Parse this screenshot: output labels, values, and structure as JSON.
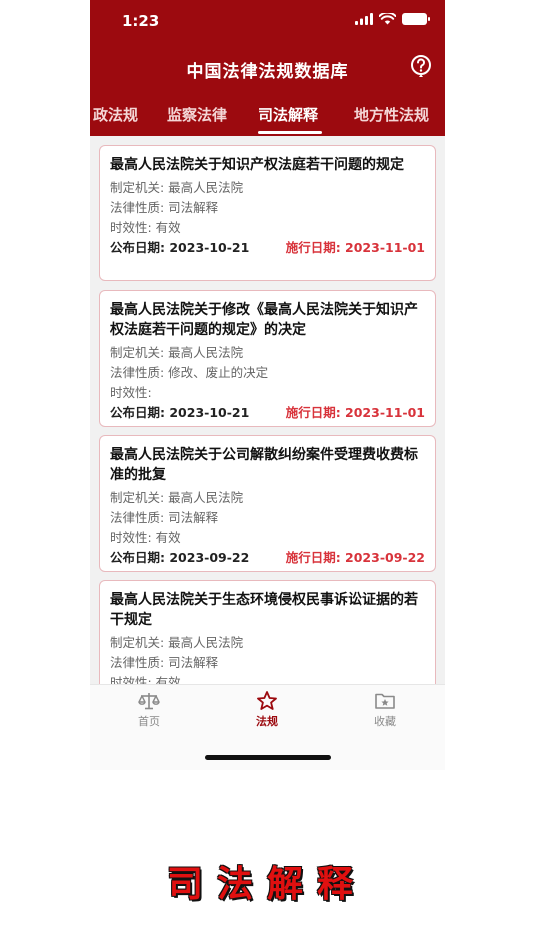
{
  "status_bar": {
    "time": "1:23"
  },
  "header": {
    "title": "中国法律法规数据库"
  },
  "tabs": [
    {
      "label": "政法规",
      "active": false
    },
    {
      "label": "监察法律",
      "active": false
    },
    {
      "label": "司法解释",
      "active": true
    },
    {
      "label": "地方性法规",
      "active": false
    }
  ],
  "cards": [
    {
      "title": "最高人民法院关于知识产权法庭若干问题的规定",
      "authority": "制定机关: 最高人民法院",
      "nature": "法律性质: 司法解释",
      "validity": "时效性: 有效",
      "publish_date": "公布日期: 2023-10-21",
      "effective_date": "施行日期: 2023-11-01"
    },
    {
      "title": "最高人民法院关于修改《最高人民法院关于知识产权法庭若干问题的规定》的决定",
      "authority": "制定机关: 最高人民法院",
      "nature": "法律性质: 修改、废止的决定",
      "validity": "时效性:",
      "publish_date": "公布日期: 2023-10-21",
      "effective_date": "施行日期: 2023-11-01"
    },
    {
      "title": "最高人民法院关于公司解散纠纷案件受理费收费标准的批复",
      "authority": "制定机关: 最高人民法院",
      "nature": "法律性质: 司法解释",
      "validity": "时效性: 有效",
      "publish_date": "公布日期: 2023-09-22",
      "effective_date": "施行日期: 2023-09-22"
    },
    {
      "title": "最高人民法院关于生态环境侵权民事诉讼证据的若干规定",
      "authority": "制定机关: 最高人民法院",
      "nature": "法律性质: 司法解释",
      "validity": "时效性: 有效",
      "publish_date": "",
      "effective_date": ""
    }
  ],
  "bottom_nav": [
    {
      "label": "首页",
      "icon": "scale-icon",
      "active": false
    },
    {
      "label": "法规",
      "icon": "star-icon",
      "active": true
    },
    {
      "label": "收藏",
      "icon": "folder-star-icon",
      "active": false
    }
  ],
  "caption": "司法解释",
  "colors": {
    "brand": "#9c0a0f",
    "effective_date": "#d8333b",
    "card_border": "#e8b9bd"
  }
}
